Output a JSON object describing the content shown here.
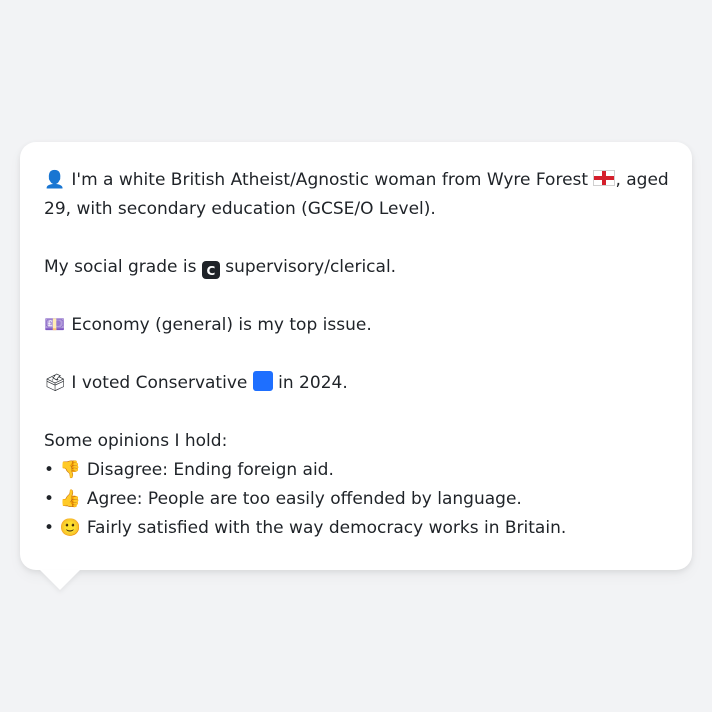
{
  "profile": {
    "line1_icon": "👤",
    "line1a": "I'm a white British Atheist/Agnostic woman from Wyre Forest",
    "line1b": ", aged",
    "line2": "29, with secondary education (GCSE/O Level).",
    "flag_icon": "england-flag-icon",
    "social_grade_prefix": "My social grade is",
    "social_grade_badge": "C",
    "social_grade_suffix": "supervisory/clerical.",
    "issue_icon": "💷",
    "issue_text": "Economy (general) is my top issue.",
    "vote_icon": "🗳",
    "vote_prefix": "I voted Conservative",
    "vote_color": "#1e6fff",
    "vote_suffix": "in 2024.",
    "opinions_header": "Some opinions I hold:",
    "opinions": [
      {
        "bullet": "•",
        "icon": "👎",
        "text": "Disagree: Ending foreign aid."
      },
      {
        "bullet": "•",
        "icon": "👍",
        "text": "Agree: People are too easily offended by language."
      },
      {
        "bullet": "•",
        "icon": "🙂",
        "text": "Fairly satisfied with the way democracy works in Britain."
      }
    ]
  }
}
